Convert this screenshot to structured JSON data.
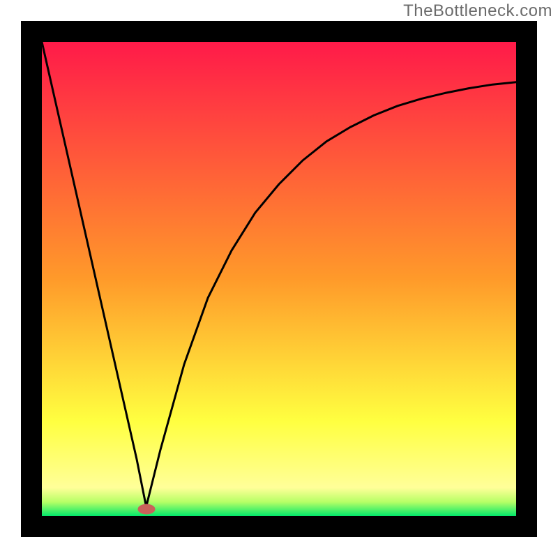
{
  "attribution": "TheBottleneck.com",
  "chart_data": {
    "type": "line",
    "title": "",
    "xlabel": "",
    "ylabel": "",
    "xlim": [
      0,
      100
    ],
    "ylim": [
      0,
      100
    ],
    "grid": false,
    "legend": false,
    "description": "Bottleneck-style curve: steep linear descent from top-left to a minimum near x≈22, then asymptotic rise toward the upper right. Background is a vertical red→orange→yellow→green gradient. A small rounded red marker sits at the curve minimum near the bottom.",
    "series": [
      {
        "name": "curve",
        "x": [
          0,
          5,
          10,
          15,
          20,
          22,
          25,
          30,
          35,
          40,
          45,
          50,
          55,
          60,
          65,
          70,
          75,
          80,
          85,
          90,
          95,
          100
        ],
        "y": [
          100,
          78,
          56,
          34,
          12,
          2,
          14,
          32,
          46,
          56,
          64,
          70,
          75,
          79,
          82,
          84.5,
          86.5,
          88,
          89.2,
          90.2,
          91,
          91.5
        ]
      }
    ],
    "marker": {
      "x": 22,
      "y": 1.5,
      "color": "#c9625a"
    },
    "gradient_stops": [
      {
        "offset": 0.0,
        "color": "#ff1a49"
      },
      {
        "offset": 0.5,
        "color": "#ff9a2a"
      },
      {
        "offset": 0.8,
        "color": "#ffff40"
      },
      {
        "offset": 0.94,
        "color": "#ffff99"
      },
      {
        "offset": 0.97,
        "color": "#b7ff66"
      },
      {
        "offset": 1.0,
        "color": "#00e86a"
      }
    ],
    "frame_color": "#000000",
    "curve_color": "#000000",
    "curve_width": 3
  }
}
